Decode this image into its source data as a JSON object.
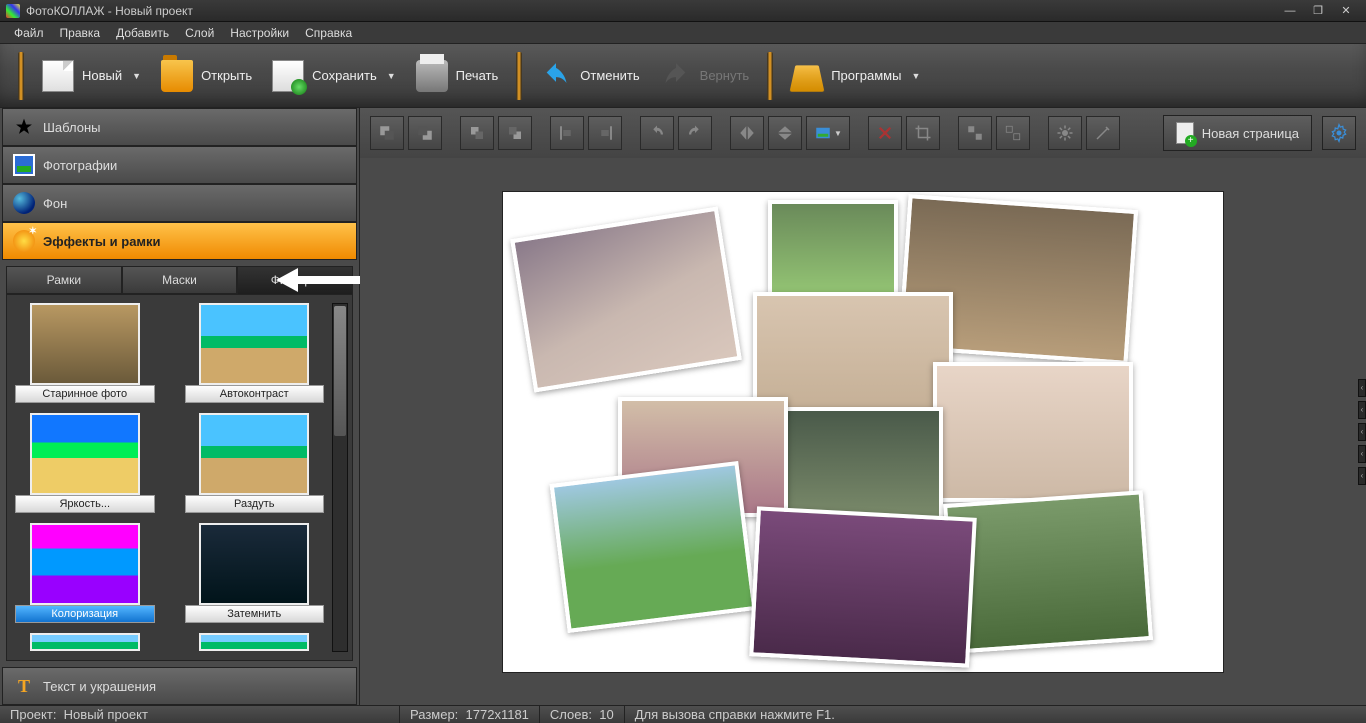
{
  "app": {
    "title": "ФотоКОЛЛАЖ - Новый проект"
  },
  "menu": [
    "Файл",
    "Правка",
    "Добавить",
    "Слой",
    "Настройки",
    "Справка"
  ],
  "toolbar": {
    "new": "Новый",
    "open": "Открыть",
    "save": "Сохранить",
    "print": "Печать",
    "undo": "Отменить",
    "redo": "Вернуть",
    "programs": "Программы"
  },
  "accordion": {
    "templates": "Шаблоны",
    "photos": "Фотографии",
    "background": "Фон",
    "effects": "Эффекты и рамки",
    "text": "Текст и украшения"
  },
  "subtabs": {
    "frames": "Рамки",
    "masks": "Маски",
    "filters": "Фильтры"
  },
  "filters": {
    "f1": "Старинное фото",
    "f2": "Автоконтраст",
    "f3": "Яркость...",
    "f4": "Раздуть",
    "f5": "Колоризация",
    "f6": "Затемнить"
  },
  "newpage": "Новая страница",
  "status": {
    "project_label": "Проект:",
    "project_name": "Новый проект",
    "size_label": "Размер:",
    "size_value": "1772x1181",
    "layers_label": "Слоев:",
    "layers_value": "10",
    "help": "Для вызова справки нажмите F1."
  }
}
